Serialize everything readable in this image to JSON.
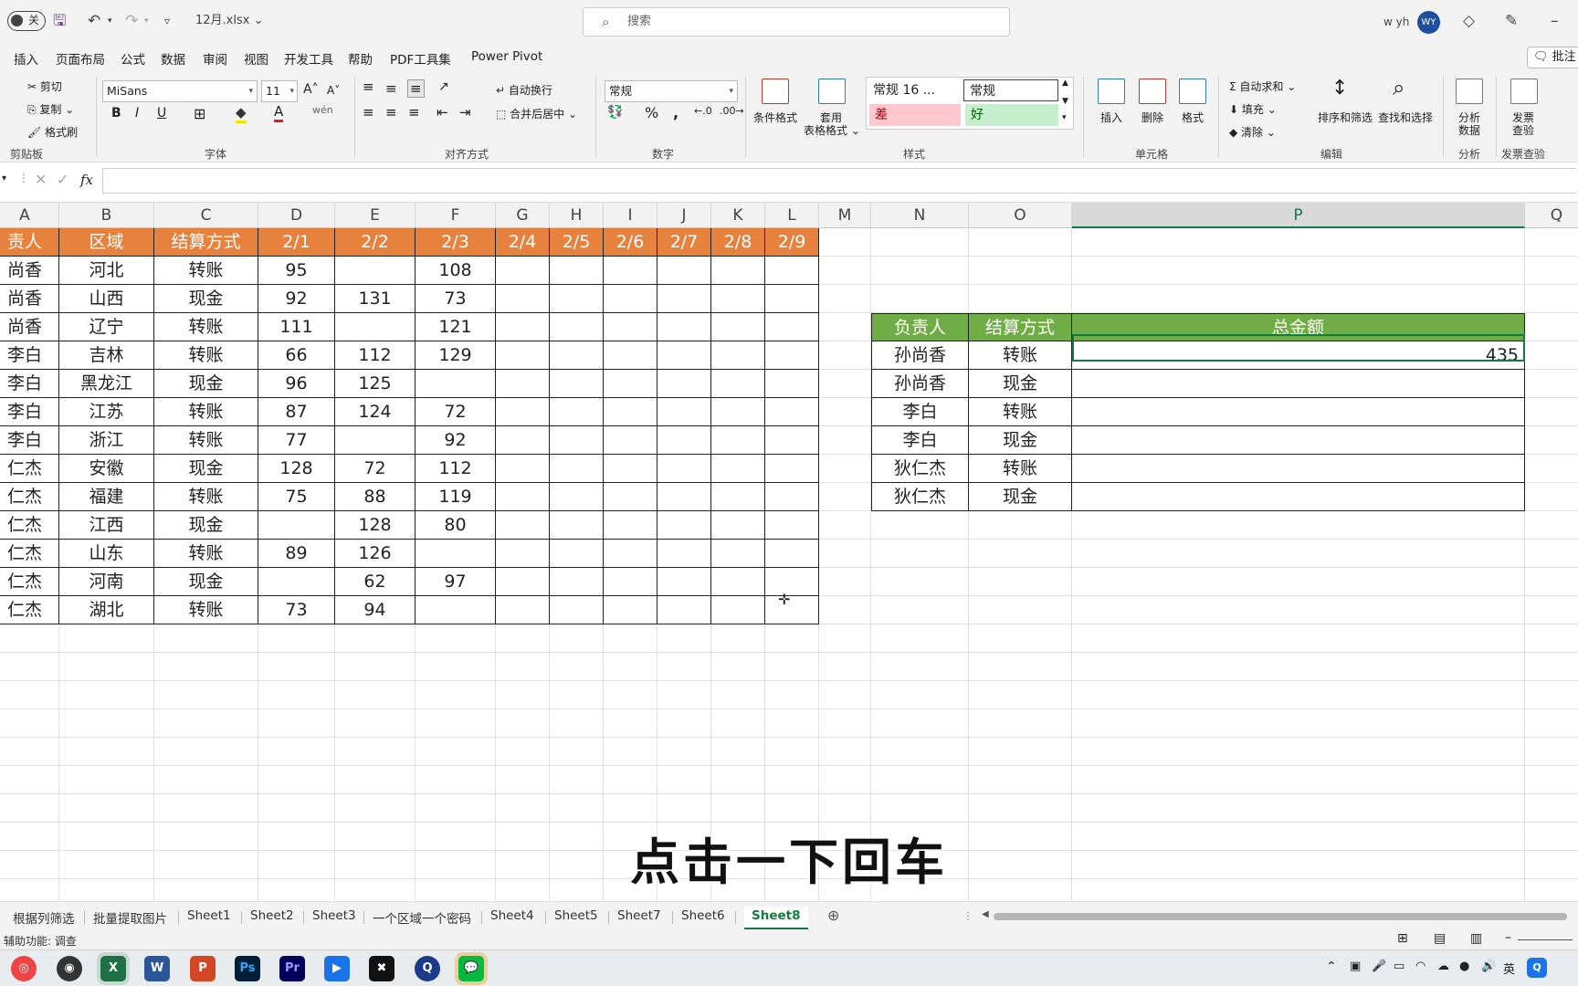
{
  "titlebar": {
    "autosave_label": "关",
    "filename": "12月.xlsx",
    "search_placeholder": "搜索",
    "user_name": "w yh",
    "user_initials": "WY"
  },
  "menu": {
    "items": [
      "插入",
      "页面布局",
      "公式",
      "数据",
      "审阅",
      "视图",
      "开发工具",
      "帮助",
      "PDF工具集",
      "Power Pivot"
    ],
    "comment_label": "批注"
  },
  "ribbon": {
    "clipboard": {
      "cut": "剪切",
      "copy": "复制",
      "format_painter": "格式刷",
      "label": "剪贴板"
    },
    "font": {
      "name": "MiSans",
      "size": "11",
      "label": "字体"
    },
    "alignment": {
      "wrap": "自动换行",
      "merge": "合并后居中",
      "label": "对齐方式"
    },
    "number": {
      "format": "常规",
      "label": "数字"
    },
    "styles": {
      "conditional": "条件格式",
      "table_format_1": "套用",
      "table_format_2": "表格格式",
      "normal16": "常规 16 ...",
      "normal": "常规",
      "bad": "差",
      "good": "好",
      "label": "样式"
    },
    "cells": {
      "insert": "插入",
      "delete": "删除",
      "format": "格式",
      "label": "单元格"
    },
    "editing": {
      "autosum": "自动求和",
      "fill": "填充",
      "clear": "清除",
      "sort": "排序和筛选",
      "find": "查找和选择",
      "label": "编辑"
    },
    "analysis": {
      "analyze_1": "分析",
      "analyze_2": "数据",
      "label": "分析"
    },
    "invoice": {
      "check_1": "发票",
      "check_2": "查验",
      "label": "发票查验"
    }
  },
  "columns": [
    "A",
    "B",
    "C",
    "D",
    "E",
    "F",
    "G",
    "H",
    "I",
    "J",
    "K",
    "L",
    "M",
    "N",
    "O",
    "P",
    "Q"
  ],
  "table1": {
    "headers": [
      "责人",
      "区域",
      "结算方式",
      "2/1",
      "2/2",
      "2/3",
      "2/4",
      "2/5",
      "2/6",
      "2/7",
      "2/8",
      "2/9"
    ],
    "rows": [
      [
        "尚香",
        "河北",
        "转账",
        "95",
        "",
        "108"
      ],
      [
        "尚香",
        "山西",
        "现金",
        "92",
        "131",
        "73"
      ],
      [
        "尚香",
        "辽宁",
        "转账",
        "111",
        "",
        "121"
      ],
      [
        "李白",
        "吉林",
        "转账",
        "66",
        "112",
        "129"
      ],
      [
        "李白",
        "黑龙江",
        "现金",
        "96",
        "125",
        ""
      ],
      [
        "李白",
        "江苏",
        "转账",
        "87",
        "124",
        "72"
      ],
      [
        "李白",
        "浙江",
        "转账",
        "77",
        "",
        "92"
      ],
      [
        "仁杰",
        "安徽",
        "现金",
        "128",
        "72",
        "112"
      ],
      [
        "仁杰",
        "福建",
        "转账",
        "75",
        "88",
        "119"
      ],
      [
        "仁杰",
        "江西",
        "现金",
        "",
        "128",
        "80"
      ],
      [
        "仁杰",
        "山东",
        "转账",
        "89",
        "126",
        ""
      ],
      [
        "仁杰",
        "河南",
        "现金",
        "",
        "62",
        "97"
      ],
      [
        "仁杰",
        "湖北",
        "转账",
        "73",
        "94",
        ""
      ]
    ]
  },
  "table2": {
    "headers": [
      "负责人",
      "结算方式",
      "总金额"
    ],
    "rows": [
      [
        "孙尚香",
        "转账",
        "435"
      ],
      [
        "孙尚香",
        "现金",
        ""
      ],
      [
        "李白",
        "转账",
        ""
      ],
      [
        "李白",
        "现金",
        ""
      ],
      [
        "狄仁杰",
        "转账",
        ""
      ],
      [
        "狄仁杰",
        "现金",
        ""
      ]
    ]
  },
  "subtitle": "点击一下回车",
  "sheets": [
    "根据列筛选",
    "批量提取图片",
    "Sheet1",
    "Sheet2",
    "Sheet3",
    "一个区域一个密码",
    "Sheet4",
    "Sheet5",
    "Sheet7",
    "Sheet6",
    "Sheet8"
  ],
  "active_sheet": "Sheet8",
  "status": "辅助功能: 调查",
  "taskbar": {
    "ime": "英"
  },
  "colors": {
    "orange_header": "#e6823e",
    "green_header": "#71ad47",
    "excel_green": "#107c41"
  }
}
